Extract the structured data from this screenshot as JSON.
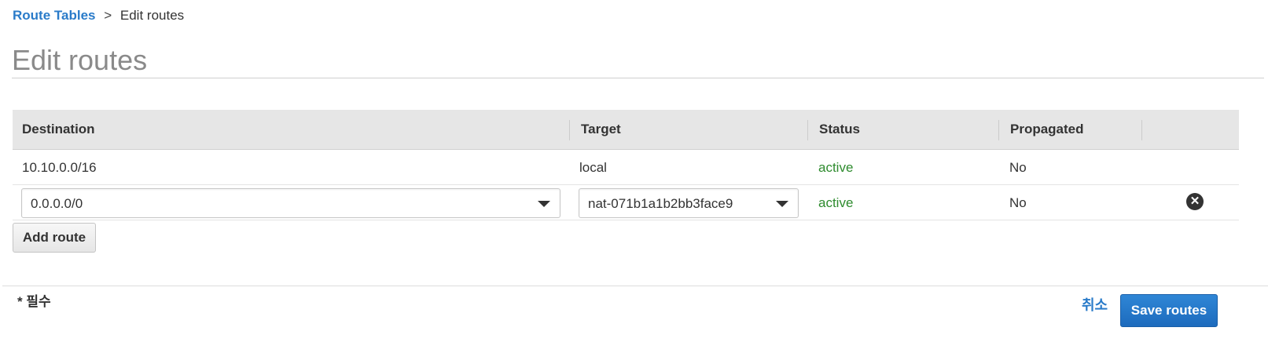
{
  "breadcrumb": {
    "parent": "Route Tables",
    "separator": ">",
    "current": "Edit routes"
  },
  "page": {
    "title": "Edit routes"
  },
  "table": {
    "headers": {
      "destination": "Destination",
      "target": "Target",
      "status": "Status",
      "propagated": "Propagated"
    },
    "rows": [
      {
        "destination": "10.10.0.0/16",
        "target": "local",
        "status": "active",
        "propagated": "No"
      },
      {
        "destination": "0.0.0.0/0",
        "target": "nat-071b1a1b2bb3face9",
        "status": "active",
        "propagated": "No",
        "editable": true
      }
    ]
  },
  "actions": {
    "add_route": "Add route",
    "cancel": "취소",
    "save": "Save routes"
  },
  "footer": {
    "required_note": "* 필수"
  },
  "colors": {
    "link": "#2a7bc9",
    "status_active": "#2e8b2e",
    "primary_button": "#1d6bbd"
  },
  "icons": {
    "remove_row": "remove-circle-icon",
    "dropdown": "chevron-down-icon"
  }
}
